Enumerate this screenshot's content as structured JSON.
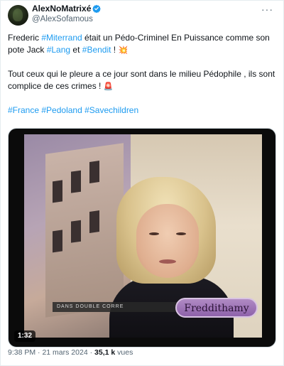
{
  "author": {
    "display_name": "AlexNoMatrixé",
    "handle": "@AlexSofamous",
    "verified_icon": "verified-badge-icon",
    "verified_color": "#1d9bf0"
  },
  "post": {
    "p1_a": "Frederic ",
    "p1_tag1": "#Miterrand",
    "p1_b": " était un Pédo-Criminel En Puissance comme son pote Jack ",
    "p1_tag2": "#Lang",
    "p1_c": " et ",
    "p1_tag3": "#Bendit",
    "p1_d": " ! ",
    "p1_emoji": "💥",
    "p2": "Tout ceux qui le pleure a ce jour sont dans le milieu Pédophile , ils sont complice de ces crimes ! ",
    "p2_emoji": "🚨",
    "tags": [
      "#France",
      "#Pedoland",
      "#Savechildren"
    ]
  },
  "video": {
    "duration": "1:32",
    "watermark": "Freddithamy",
    "lower_third": "DANS DOUBLE CORRE"
  },
  "meta": {
    "time": "9:38 PM",
    "sep1": " · ",
    "date": "21 mars 2024",
    "sep2": " · ",
    "views_count": "35,1 k",
    "views_label": " vues"
  },
  "colors": {
    "link": "#1d9bf0",
    "text": "#0f1419",
    "muted": "#536471"
  }
}
